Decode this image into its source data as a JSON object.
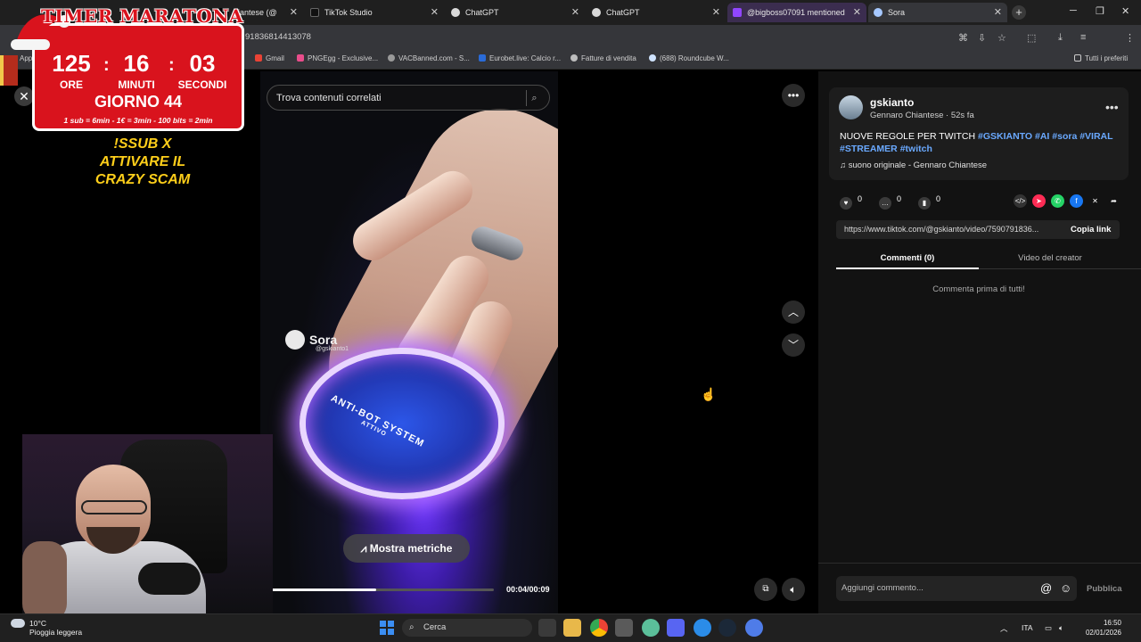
{
  "browser": {
    "tabs": [
      {
        "label": "hiantese (@",
        "color": "#ff5a5a"
      },
      {
        "label": "TikTok Studio",
        "color": "#ffffff"
      },
      {
        "label": "ChatGPT",
        "color": "#d9d9d9"
      },
      {
        "label": "ChatGPT",
        "color": "#d9d9d9"
      },
      {
        "label": "@bigboss07091 mentioned",
        "color": "#9146ff"
      },
      {
        "label": "Sora",
        "color": "#a6c8ff"
      }
    ],
    "url": "91836814413078",
    "bookmarks": [
      {
        "label": "Gmail",
        "color": "#ea4335"
      },
      {
        "label": "PNGEgg - Exclusive...",
        "color": "#e94d8b"
      },
      {
        "label": "VACBanned.com - S...",
        "color": "#9a9a9a"
      },
      {
        "label": "Eurobet.live: Calcio r...",
        "color": "#2a6bd8"
      },
      {
        "label": "Fatture di vendita",
        "color": "#bdbdbd"
      },
      {
        "label": "(688) Roundcube W...",
        "color": "#cfe3ff"
      }
    ],
    "bookmarks_right": "Tutti i preferiti",
    "bookmarks_left_partial": "App"
  },
  "player": {
    "search_text": "Trova contenuti correlati",
    "watermark_brand": "Sora",
    "watermark_handle": "@gskianto1",
    "button_text": "ANTI-BOT SYSTEM",
    "button_subtext": "ATTIVO",
    "metrics_label": "Mostra metriche",
    "time": "00:04/00:09",
    "progress": 0.47
  },
  "post": {
    "username": "gskianto",
    "fullname": "Gennaro Chiantese",
    "sep": "·",
    "age": "52s fa",
    "caption_text": "NUOVE REGOLE PER TWITCH ",
    "tags": [
      "#GSKIANTO",
      "#AI",
      "#sora",
      "#VIRAL",
      "#STREAMER",
      "#twitch"
    ],
    "sound": "suono originale - Gennaro Chiantese",
    "likes": "0",
    "comments": "0",
    "saves": "0",
    "link": "https://www.tiktok.com/@gskianto/video/7590791836...",
    "copy_label": "Copia link",
    "tab_comments": "Commenti (0)",
    "tab_creator": "Video del creator",
    "empty_comments": "Commenta prima di tutti!",
    "comment_placeholder": "Aggiungi commento...",
    "publish_label": "Pubblica"
  },
  "overlay": {
    "title": "TIMER MARATONA",
    "hours": "125",
    "minutes": "16",
    "seconds": "03",
    "hours_label": "ORE",
    "minutes_label": "MINUTI",
    "seconds_label": "SECONDI",
    "day": "GIORNO 44",
    "rules": "1 sub = 6min - 1€ = 3min - 100 bits = 2min",
    "promo_line1": "!SSUB X",
    "promo_line2": "ATTIVARE IL",
    "promo_line3": "CRAZY SCAM"
  },
  "taskbar": {
    "temp": "10°C",
    "weather": "Pioggia leggera",
    "search": "Cerca",
    "lang": "ITA",
    "time": "16:50",
    "date": "02/01/2026"
  },
  "colors": {
    "tiktok_tag": "#6aa9ff",
    "timer_red": "#d9131d",
    "promo_yellow": "#ffcf1a"
  }
}
